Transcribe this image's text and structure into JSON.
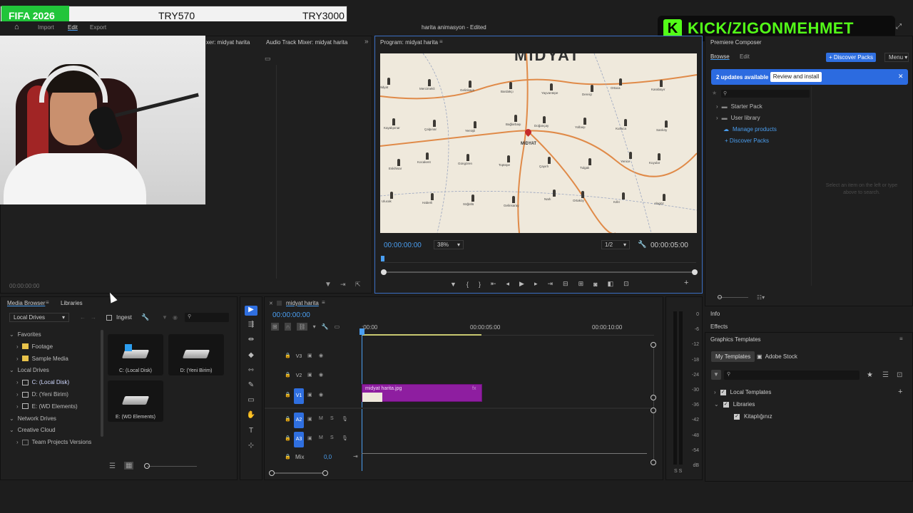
{
  "overlay": {
    "game_label": "FIFA 2026",
    "price_1": "TRY570",
    "price_2": "TRY3000",
    "streamer": "KICK/ZIGONMEHMET"
  },
  "menu": {
    "items": [
      "Import",
      "Edit",
      "Export"
    ],
    "title": "harita animasyon",
    "status": "- Edited"
  },
  "source": {
    "tabs": [
      "xer: midyat harita",
      "Audio Track Mixer: midyat harita"
    ],
    "timecode": "00:00:00:00"
  },
  "program": {
    "tab": "Program: midyat harita",
    "map_title": "MIDYAT",
    "center_label": "MİDYAT",
    "timecode": "00:00:00:00",
    "zoom": "38%",
    "resolution": "1/2",
    "duration": "00:00:05:00",
    "places": [
      {
        "n": "Midyat"
      },
      {
        "n": "Mercimekli"
      },
      {
        "n": "Gelinkaya"
      },
      {
        "n": "Bardakçı"
      },
      {
        "n": "Yayvantepe"
      },
      {
        "n": "Dereiçi"
      },
      {
        "n": "Ortaca"
      },
      {
        "n": "Karabayır"
      },
      {
        "n": "Kayalıpınar"
      },
      {
        "n": "Çalpınar"
      },
      {
        "n": "Yemişli"
      },
      {
        "n": "Bağlarbaşı"
      },
      {
        "n": "Doğançay"
      },
      {
        "n": "Yolbaşı"
      },
      {
        "n": "Kutluca"
      },
      {
        "n": "Sarıköy"
      },
      {
        "n": "Eskihisar"
      },
      {
        "n": "Kocakent"
      },
      {
        "n": "Güngören"
      },
      {
        "n": "Toptepe"
      },
      {
        "n": "Çayırlı"
      },
      {
        "n": "Tulgalı"
      },
      {
        "n": "Yenice"
      },
      {
        "n": "Kuyular"
      },
      {
        "n": "Ulucak"
      },
      {
        "n": "Haberli"
      },
      {
        "n": "Söğütlü"
      },
      {
        "n": "Gelinsaray"
      },
      {
        "n": "Narlı"
      },
      {
        "n": "Ortaköy"
      },
      {
        "n": "Kıllıt"
      },
      {
        "n": "Alagöz"
      }
    ]
  },
  "composer": {
    "title": "Premiere Composer",
    "tabs": [
      "Browse",
      "Edit"
    ],
    "discover_btn": "+ Discover Packs",
    "menu": "Menu",
    "updates": "2 updates available",
    "review_btn": "Review and install",
    "tree": [
      "Starter Pack",
      "User library",
      "Manage products",
      "+ Discover Packs"
    ],
    "empty_text": "Select an item on the left or type above to search."
  },
  "side_tabs": {
    "info": "Info",
    "effects": "Effects",
    "graphics": "Graphics Templates"
  },
  "graphics": {
    "tabs": [
      "My Templates",
      "Adobe Stock"
    ],
    "tree": [
      "Local Templates",
      "Libraries",
      "Kitaplığınız"
    ]
  },
  "media_browser": {
    "tabs": [
      "Media Browser",
      "Libraries"
    ],
    "location": "Local Drives",
    "ingest": "Ingest",
    "tree": [
      {
        "label": "Favorites",
        "indent": 0,
        "icon": "",
        "blue": false
      },
      {
        "label": "Footage",
        "indent": 1,
        "icon": "folder",
        "blue": false
      },
      {
        "label": "Sample Media",
        "indent": 1,
        "icon": "folder",
        "blue": false
      },
      {
        "label": "Local Drives",
        "indent": 0,
        "icon": "",
        "blue": false
      },
      {
        "label": "C: (Local Disk)",
        "indent": 1,
        "icon": "drive",
        "blue": true
      },
      {
        "label": "D: (Yeni Birim)",
        "indent": 1,
        "icon": "drive",
        "blue": false
      },
      {
        "label": "E: (WD Elements)",
        "indent": 1,
        "icon": "drive",
        "blue": false
      },
      {
        "label": "Network Drives",
        "indent": 0,
        "icon": "",
        "blue": false
      },
      {
        "label": "Creative Cloud",
        "indent": 0,
        "icon": "",
        "blue": false
      },
      {
        "label": "Team Projects Versions",
        "indent": 1,
        "icon": "doc",
        "blue": false
      }
    ],
    "thumbs": [
      "C: (Local Disk)",
      "D: (Yeni Birim)",
      "E: (WD Elements)"
    ]
  },
  "timeline": {
    "tab": "midyat harita",
    "timecode": "00:00:00:00",
    "ruler": [
      ":00:00",
      "00:00:05:00",
      "00:00:10:00"
    ],
    "tracks": [
      "V3",
      "V2",
      "V1",
      "A2",
      "A3"
    ],
    "mix_label": "Mix",
    "mix_value": "0,0",
    "clip_name": "midyat harita.jpg"
  },
  "meters": {
    "scale": [
      "0",
      "-6",
      "-12",
      "-18",
      "-24",
      "-30",
      "-36",
      "-42",
      "-48",
      "-54",
      "dB"
    ],
    "solo": "S S"
  }
}
